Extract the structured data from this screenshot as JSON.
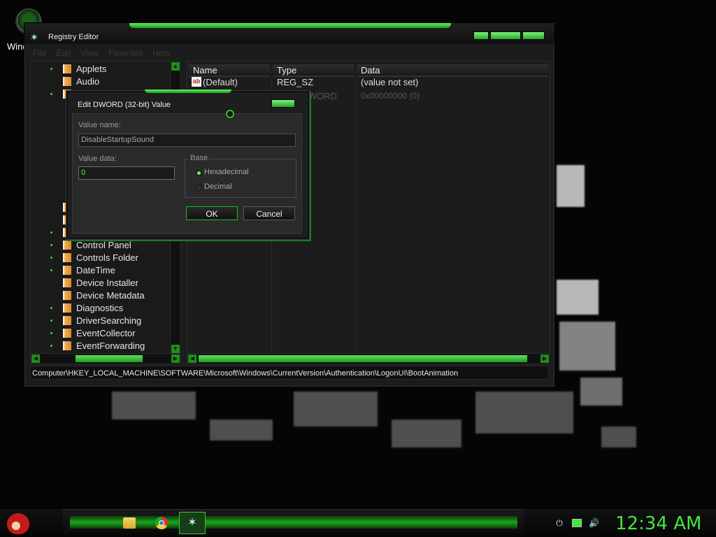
{
  "desktop": {
    "icon_label": "Windows V"
  },
  "regedit": {
    "title": "Registry Editor",
    "menu": [
      "File",
      "Edit",
      "View",
      "Favorites",
      "Help"
    ],
    "tree_items_top": [
      "Applets",
      "Audio"
    ],
    "tree_items_bottom": [
      "Control Panel",
      "Controls Folder",
      "DateTime",
      "Device Installer",
      "Device Metadata",
      "Diagnostics",
      "DriverSearching",
      "EventCollector",
      "EventForwarding"
    ],
    "columns": [
      "Name",
      "Type",
      "Data"
    ],
    "rows": [
      {
        "name": "(Default)",
        "type": "REG_SZ",
        "data": "(value not set)"
      },
      {
        "name": "",
        "type": "REG_DWORD",
        "data": "0x00000000 (0)"
      }
    ],
    "status_path": "Computer\\HKEY_LOCAL_MACHINE\\SOFTWARE\\Microsoft\\Windows\\CurrentVersion\\Authentication\\LogonUI\\BootAnimation"
  },
  "dialog": {
    "title": "Edit DWORD (32-bit) Value",
    "value_name_label": "Value name:",
    "value_name": "DisableStartupSound",
    "value_data_label": "Value data:",
    "value_data": "0",
    "base_label": "Base",
    "base_options": [
      "Hexadecimal",
      "Decimal"
    ],
    "base_selected": "Hexadecimal",
    "ok_label": "OK",
    "cancel_label": "Cancel"
  },
  "taskbar": {
    "clock": "12:34 AM",
    "accent_color": "#3ee83e"
  },
  "icons": [
    "start-orb-icon",
    "folder-icon",
    "chrome-icon",
    "regedit-icon",
    "power-icon",
    "network-icon",
    "volume-icon"
  ]
}
